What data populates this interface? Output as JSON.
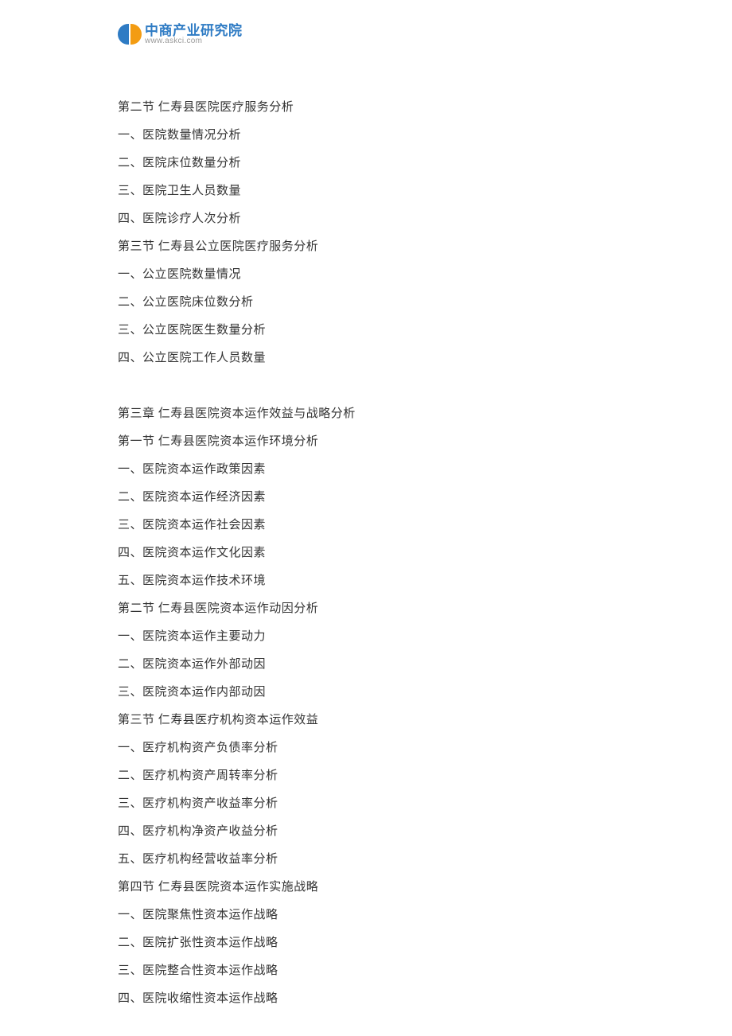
{
  "logo": {
    "cn": "中商产业研究院",
    "url": "www.askci.com"
  },
  "toc": {
    "lines": [
      "第二节 仁寿县医院医疗服务分析",
      "一、医院数量情况分析",
      "二、医院床位数量分析",
      "三、医院卫生人员数量",
      "四、医院诊疗人次分析",
      "第三节 仁寿县公立医院医疗服务分析",
      "一、公立医院数量情况",
      "二、公立医院床位数分析",
      "三、公立医院医生数量分析",
      "四、公立医院工作人员数量",
      "",
      "第三章 仁寿县医院资本运作效益与战略分析",
      "第一节 仁寿县医院资本运作环境分析",
      "一、医院资本运作政策因素",
      "二、医院资本运作经济因素",
      "三、医院资本运作社会因素",
      "四、医院资本运作文化因素",
      "五、医院资本运作技术环境",
      "第二节 仁寿县医院资本运作动因分析",
      "一、医院资本运作主要动力",
      "二、医院资本运作外部动因",
      "三、医院资本运作内部动因",
      "第三节 仁寿县医疗机构资本运作效益",
      "一、医疗机构资产负债率分析",
      "二、医疗机构资产周转率分析",
      "三、医疗机构资产收益率分析",
      "四、医疗机构净资产收益分析",
      "五、医疗机构经营收益率分析",
      "第四节 仁寿县医院资本运作实施战略",
      "一、医院聚焦性资本运作战略",
      "二、医院扩张性资本运作战略",
      "三、医院整合性资本运作战略",
      "四、医院收缩性资本运作战略"
    ]
  }
}
